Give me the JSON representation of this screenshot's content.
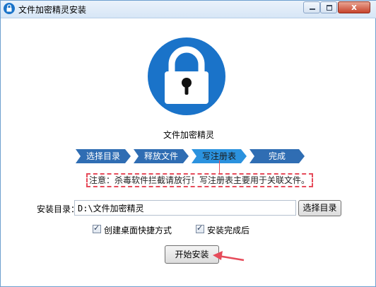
{
  "window": {
    "title": "文件加密精灵安装",
    "close_label": "x"
  },
  "product": {
    "name": "文件加密精灵",
    "logo_color": "#1a73c9"
  },
  "steps": [
    {
      "label": "选择目录",
      "active": false
    },
    {
      "label": "释放文件",
      "active": false
    },
    {
      "label": "写注册表",
      "active": true
    },
    {
      "label": "完成",
      "active": false
    }
  ],
  "step_colors": {
    "normal": "#2f6db3",
    "active": "#2b92de"
  },
  "notice": "注意：杀毒软件拦截请放行！写注册表主要用于关联文件。",
  "install_dir": {
    "label": "安装目录：",
    "value": "D:\\文件加密精灵",
    "browse_label": "选择目录"
  },
  "options": {
    "desktop_shortcut": {
      "label": "创建桌面快捷方式",
      "checked": true
    },
    "after_install": {
      "label": "安装完成后",
      "checked": true
    }
  },
  "install_button": "开始安装",
  "annotation_color": "#e64b5a"
}
